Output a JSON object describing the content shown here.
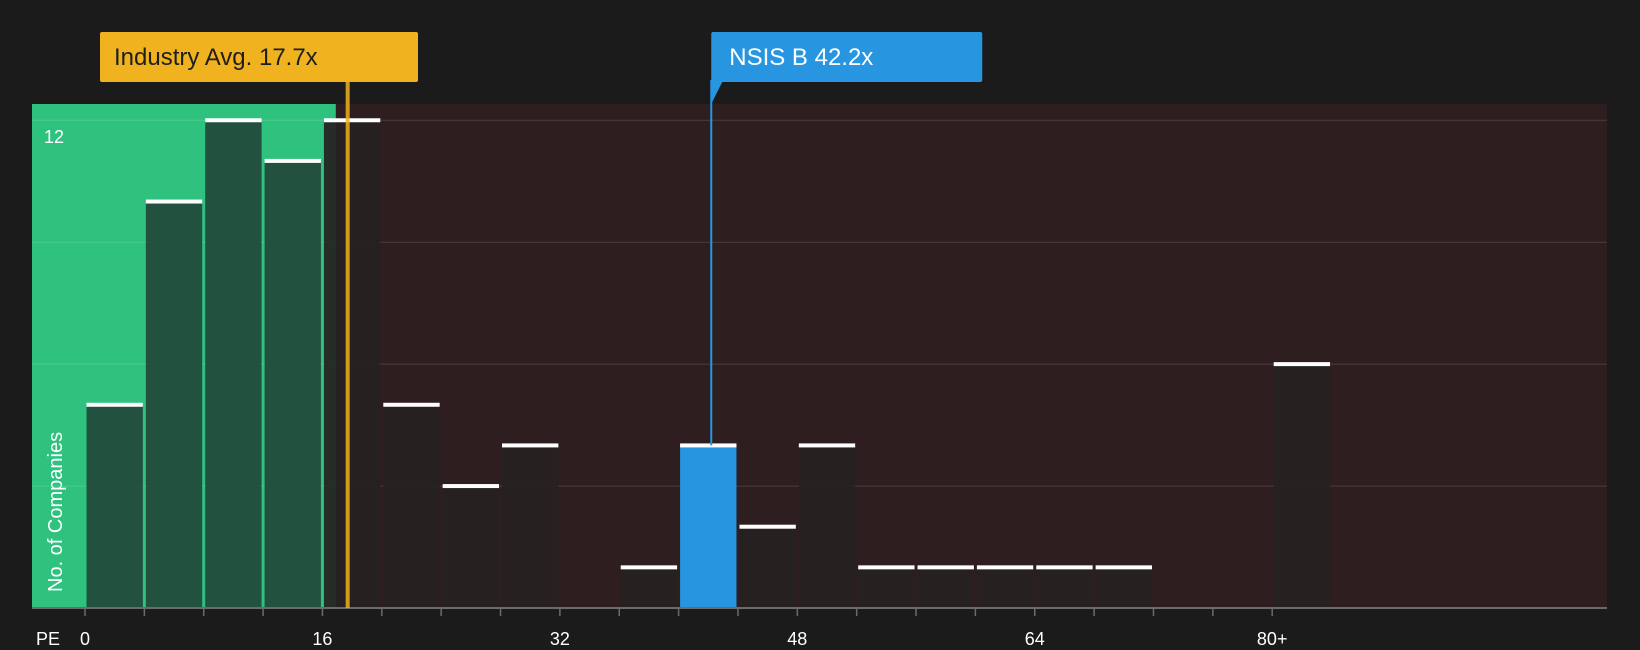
{
  "chart_data": {
    "type": "bar",
    "xlabel": "PE",
    "ylabel": "No. of Companies",
    "x_ticks": [
      "0",
      "16",
      "32",
      "48",
      "64",
      "80+"
    ],
    "y_ticks": [
      "12"
    ],
    "ylim": [
      0,
      12.4
    ],
    "bin_width": 4,
    "bins": [
      {
        "start": 0,
        "value": 5
      },
      {
        "start": 4,
        "value": 10
      },
      {
        "start": 8,
        "value": 12
      },
      {
        "start": 12,
        "value": 11
      },
      {
        "start": 16,
        "value": 12
      },
      {
        "start": 20,
        "value": 5
      },
      {
        "start": 24,
        "value": 3
      },
      {
        "start": 28,
        "value": 4
      },
      {
        "start": 36,
        "value": 1
      },
      {
        "start": 40,
        "value": 4,
        "highlight": true
      },
      {
        "start": 44,
        "value": 2
      },
      {
        "start": 48,
        "value": 4
      },
      {
        "start": 52,
        "value": 1
      },
      {
        "start": 56,
        "value": 1
      },
      {
        "start": 60,
        "value": 1
      },
      {
        "start": 64,
        "value": 1
      },
      {
        "start": 68,
        "value": 1
      },
      {
        "start": 80,
        "value": 6
      }
    ],
    "industry_avg": {
      "value": 17.7,
      "label": "Industry Avg. 17.7x"
    },
    "company": {
      "value": 42.2,
      "label": "NSIS B 42.2x"
    },
    "fair_range_max": 16.9,
    "colors": {
      "background": "#1b1b1b",
      "fair_zone": "#2ec27e",
      "expensive_zone": "#2e1e1f",
      "bar_in_fair": "#23483a",
      "bar_default": "#262121",
      "bar_highlight": "#2795e0",
      "industry_marker": "#f0b21f",
      "company_marker": "#2795e0"
    },
    "grid": true
  }
}
